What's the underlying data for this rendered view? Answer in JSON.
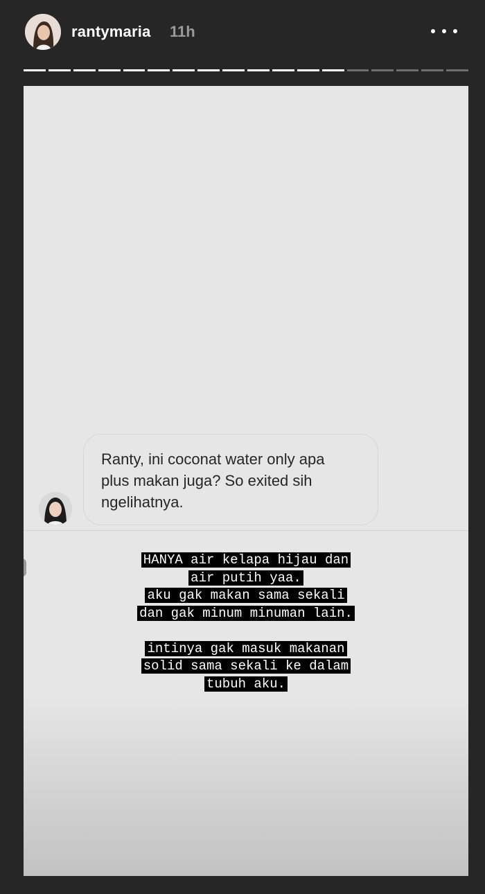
{
  "header": {
    "username": "rantymaria",
    "time": "11h",
    "more_icon": "more-horizontal-icon"
  },
  "progress": {
    "segments": 18,
    "completed": 13
  },
  "question": {
    "text_lines": [
      "Ranty, ini coconat water only apa",
      "plus makan juga? So exited sih",
      "ngelihatnya."
    ]
  },
  "reply": {
    "lines": [
      "HANYA air kelapa hijau dan",
      "air putih yaa.",
      "aku gak makan sama sekali",
      "dan gak minum minuman lain.",
      "",
      "intinya gak masuk makanan",
      "solid sama sekali ke dalam",
      "tubuh aku."
    ]
  },
  "colors": {
    "background": "#262626",
    "story_bg": "#e6e6e6",
    "text_highlight": "#000000"
  }
}
